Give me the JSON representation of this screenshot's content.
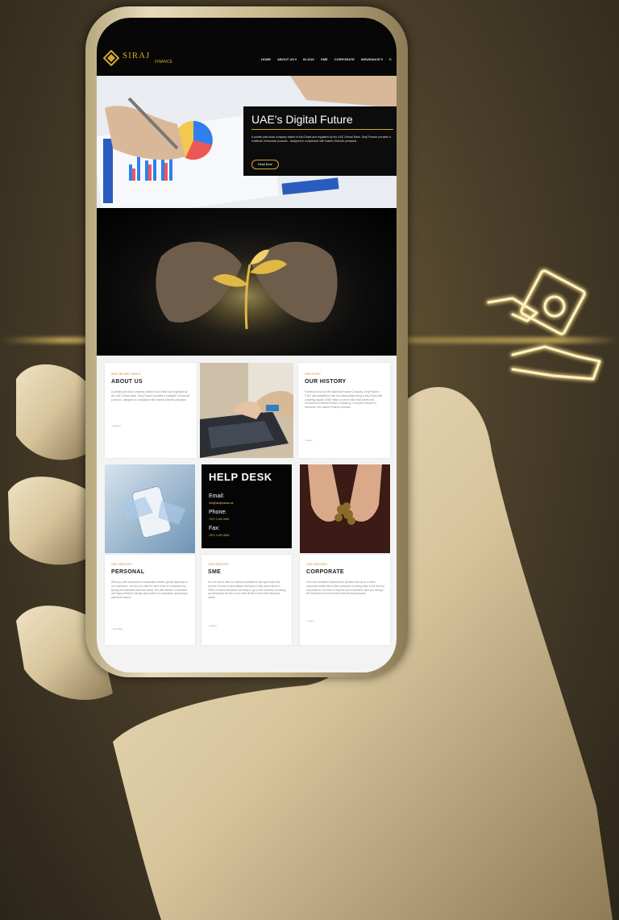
{
  "nav": {
    "logo_text": "SIRAJ",
    "logo_sub": "FINANCE",
    "items": [
      "HOME",
      "ABOUT US ▾",
      "IN 2021",
      "SME",
      "CORPORATE",
      "INSURANCE ▾",
      "C"
    ]
  },
  "hero": {
    "title": "UAE's Digital Future",
    "text": "A private joint stock company based in Abu Dhabi and regulated by the UAE Central Bank. Siraj Finance provides a multitude of financial products - designed in compliance with Islamic Shari'ah principles.",
    "button": "Read More"
  },
  "cards": {
    "about": {
      "eyebrow": "WHO WE ARE / ABOUT",
      "title": "ABOUT US",
      "text": "A private joint stock company based in Abu Dhabi and regulated by the UAE Central Bank. Siraj Finance provides a multitude of financial products - designed in compliance with Islamic Shari'ah principles.",
      "link": "› Explore"
    },
    "history": {
      "eyebrow": "OUR STORY",
      "title": "OUR HISTORY",
      "text": "Formerly known as the Mashreq Finance Company, Siraj Finance PJSC was established with the intermediate being in Abu Dhabi with a starting capital of 550 million to serve both retail clients and Government Related Entities, in Banking, Consumer Finance & Insurance, like Islamic Finance products.",
      "link": "› Learn"
    },
    "personal": {
      "eyebrow": "OUR SERVICES",
      "title": "PERSONAL",
      "text": "With you, with customers in sustainable wealth, growth depends on our customers, our aim is to offer the best value for consumers by joining the Individual Business needs. We offer flexible, convenient and highly effective savings plans within our standards according to individual finance.",
      "link": "› Get More"
    },
    "sme": {
      "eyebrow": "OUR SERVICES",
      "title": "SME",
      "text": "It is our aim to offer our clients accessible to the right funds and service in terms of personalized services or help when clients & SMEs & retail businesses are ready to go on the business, providing a professional service to our valid clients to meet their business needs.",
      "link": "› Inquire"
    },
    "corporate": {
      "eyebrow": "OUR SERVICES",
      "title": "CORPORATE",
      "text": "In its fast consistent framework to demand rise up for a wider corporate market that is filled presence of asking value in the field for corporations. Our team of experts and consultants offer you through the investment services that meets financial security.",
      "link": "› Learn"
    }
  },
  "helpdesk": {
    "title": "HELP DESK",
    "email_label": "Email:",
    "email_value": "info@sirajfinance.ae",
    "phone_label": "Phone:",
    "phone_value": "+971 2 x00 0000",
    "fax_label": "Fax:",
    "fax_value": "+971 2 x00 0000"
  },
  "colors": {
    "accent": "#d6a531",
    "eyebrow": "#d6862a",
    "nav_bg": "#070707"
  },
  "icons": [
    "logo-mark-icon",
    "money-hand-icon"
  ]
}
